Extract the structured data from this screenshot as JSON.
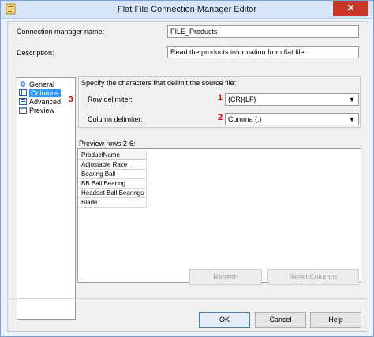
{
  "window": {
    "title": "Flat File Connection Manager Editor",
    "close_label": "✕"
  },
  "form": {
    "name_label": "Connection manager name:",
    "name_value": "FILE_Products",
    "description_label": "Description:",
    "description_value": "Read the products information from flat file."
  },
  "nav": {
    "items": [
      {
        "label": "General",
        "icon": "general-icon"
      },
      {
        "label": "Columns",
        "icon": "columns-icon",
        "selected": true
      },
      {
        "label": "Advanced",
        "icon": "advanced-icon"
      },
      {
        "label": "Preview",
        "icon": "preview-icon"
      }
    ]
  },
  "delimiters": {
    "heading": "Specify the characters that delimit the source file:",
    "row_label": "Row delimiter:",
    "row_value": "{CR}{LF}",
    "column_label": "Column delimiter:",
    "column_value": "Comma {,}"
  },
  "preview": {
    "label": "Preview rows 2-6:",
    "header": "ProductName",
    "rows": [
      "Adjustable Race",
      "Bearing Ball",
      "BB Ball Bearing",
      "Headset Ball Bearings",
      "Blade"
    ]
  },
  "annotations": {
    "one": "1",
    "two": "2",
    "three": "3"
  },
  "buttons": {
    "refresh": "Refresh",
    "reset_columns": "Reset Columns",
    "ok": "OK",
    "cancel": "Cancel",
    "help": "Help"
  },
  "colors": {
    "badge": "#d00000",
    "selection": "#3399ff",
    "close": "#c7382a"
  }
}
